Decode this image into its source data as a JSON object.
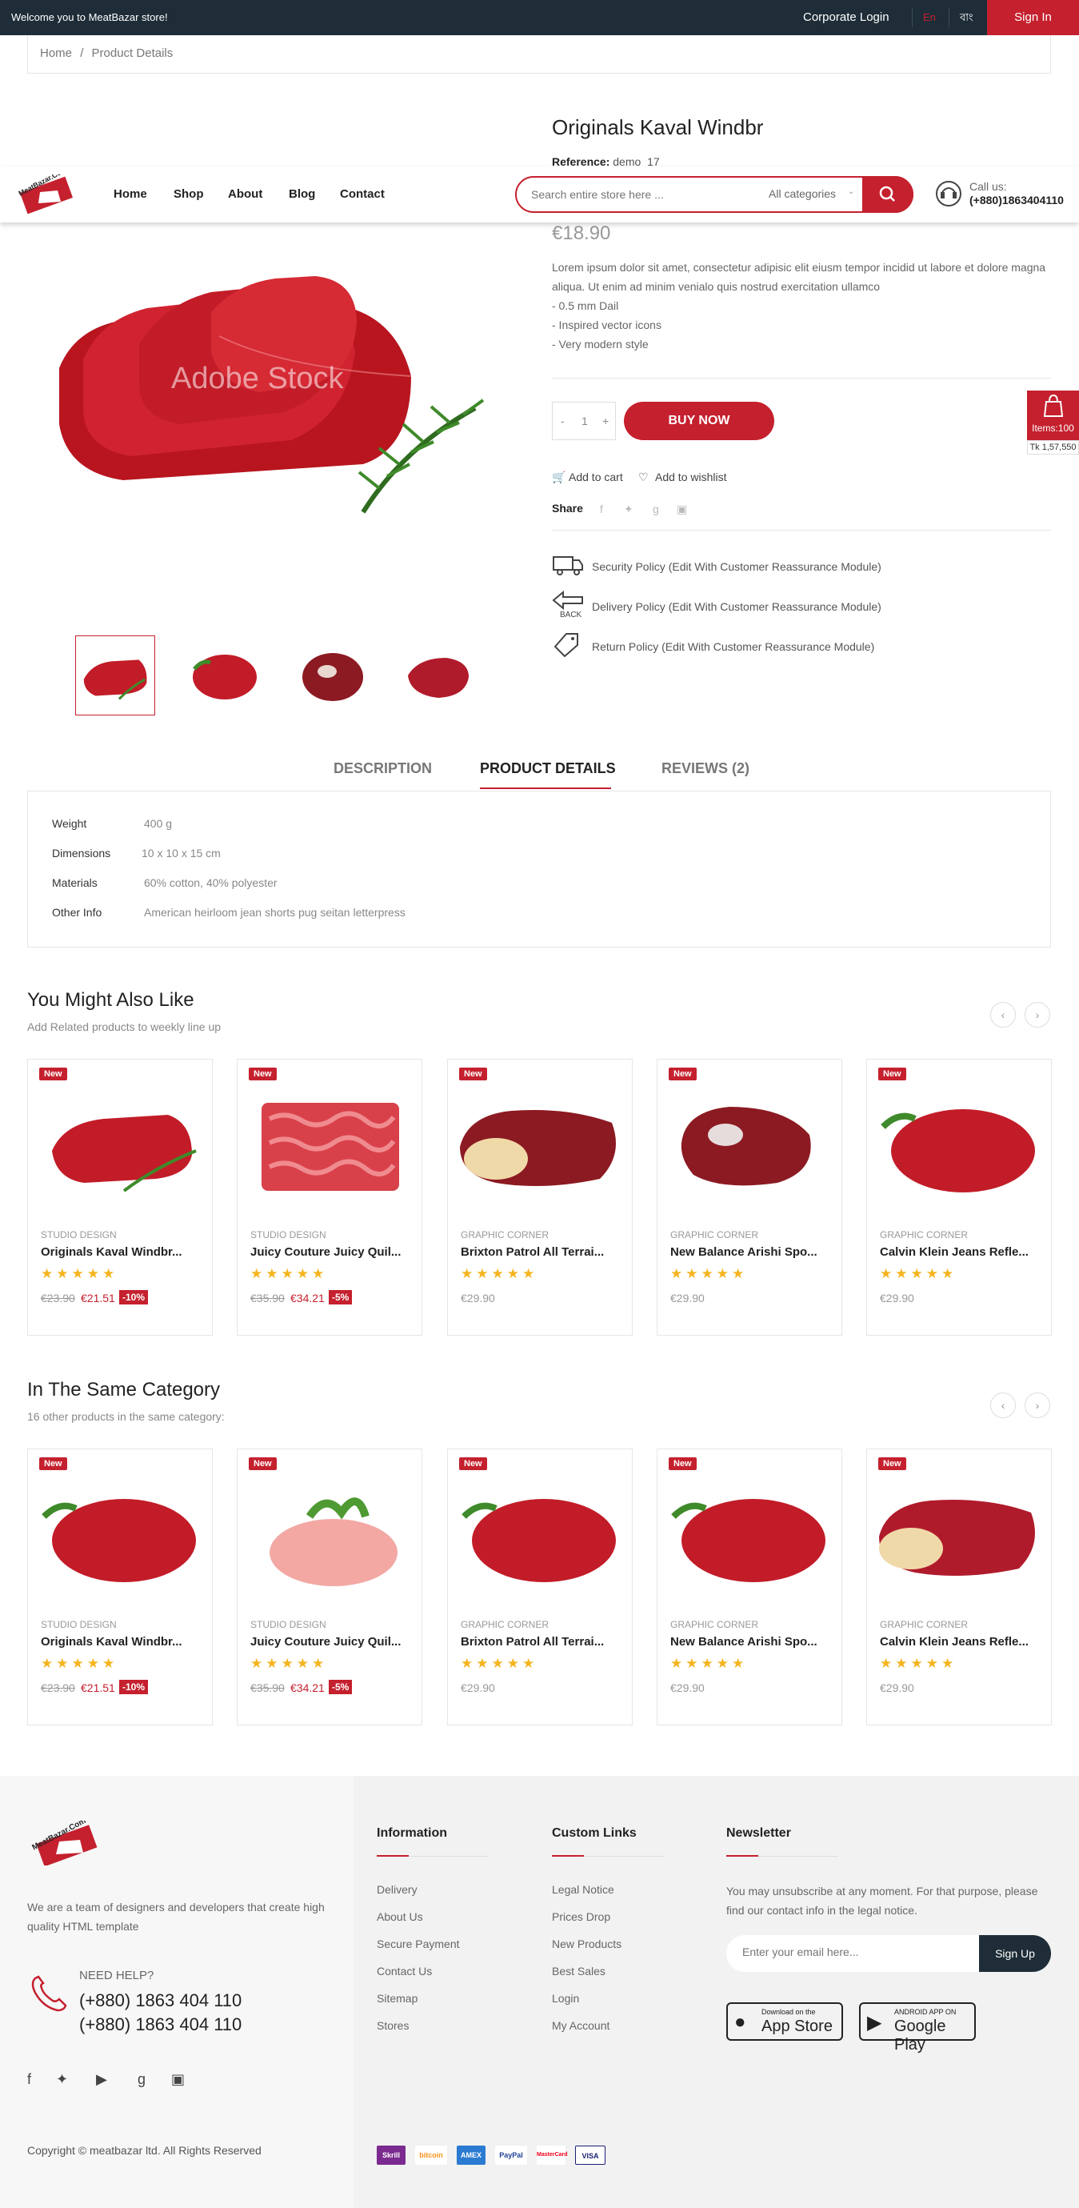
{
  "topbar": {
    "welcome": "Welcome you to MeatBazar store!",
    "corporate_login": "Corporate Login",
    "lang_en": "En",
    "lang_bn": "বাং",
    "sign_in": "Sign In"
  },
  "breadcrumb": {
    "home": "Home",
    "sep": "/",
    "current": "Product Details"
  },
  "header": {
    "logo_text": "MeatBazar.Com",
    "nav": [
      "Home",
      "Shop",
      "About",
      "Blog",
      "Contact"
    ],
    "search_placeholder": "Search entire store here ...",
    "category": "All categories",
    "call_label": "Call us:",
    "call_number": "(+880)1863404110"
  },
  "product": {
    "title": "Originals Kaval Windbr",
    "reference_label": "Reference:",
    "reference_value": "demo_17",
    "price": "€18.90",
    "description": "Lorem ipsum dolor sit amet, consectetur adipisic elit eiusm tempor incidid ut labore et dolore magna aliqua. Ut enim ad minim venialo quis nostrud exercitation ullamco",
    "features": [
      "- 0.5 mm Dail",
      "- Inspired vector icons",
      "- Very modern style"
    ],
    "qty_minus": "-",
    "qty_value": "1",
    "qty_plus": "+",
    "buy_now": "BUY NOW",
    "add_to_cart": "Add to cart",
    "add_to_wishlist": "Add to wishlist",
    "share_label": "Share",
    "policies": [
      "Security Policy (Edit With Customer Reassurance Module)",
      "Delivery Policy (Edit With Customer Reassurance Module)",
      "Return Policy (Edit With Customer Reassurance Module)"
    ],
    "watermark": "Adobe Stock"
  },
  "cart_float": {
    "items": "Items:100",
    "total": "Tk 1,57,550"
  },
  "tabs": [
    "DESCRIPTION",
    "PRODUCT DETAILS",
    "REVIEWS (2)"
  ],
  "details": [
    {
      "label": "Weight",
      "value": "400 g"
    },
    {
      "label": "Dimensions",
      "value": "10 x 10 x 15 cm"
    },
    {
      "label": "Materials",
      "value": "60% cotton, 40% polyester"
    },
    {
      "label": "Other Info",
      "value": "American heirloom jean shorts pug seitan letterpress"
    }
  ],
  "related": {
    "title": "You Might Also Like",
    "subtitle": "Add Related products to weekly line up",
    "prev": "‹",
    "next": "›",
    "products": [
      {
        "badge": "New",
        "brand": "STUDIO DESIGN",
        "name": "Originals Kaval Windbr...",
        "stars": "★★★★★",
        "old_price": "€23.90",
        "price": "€21.51",
        "discount": "-10%"
      },
      {
        "badge": "New",
        "brand": "STUDIO DESIGN",
        "name": "Juicy Couture Juicy Quil...",
        "stars": "★★★★★",
        "old_price": "€35.90",
        "price": "€34.21",
        "discount": "-5%"
      },
      {
        "badge": "New",
        "brand": "GRAPHIC CORNER",
        "name": "Brixton Patrol All Terrai...",
        "stars": "★★★★★",
        "price": "€29.90"
      },
      {
        "badge": "New",
        "brand": "GRAPHIC CORNER",
        "name": "New Balance Arishi Spo...",
        "stars": "★★★★★",
        "price": "€29.90"
      },
      {
        "badge": "New",
        "brand": "GRAPHIC CORNER",
        "name": "Calvin Klein Jeans Refle...",
        "stars": "★★★★★",
        "price": "€29.90"
      }
    ]
  },
  "same_category": {
    "title": "In The Same Category",
    "subtitle": "16 other products in the same category:",
    "prev": "‹",
    "next": "›",
    "products": [
      {
        "badge": "New",
        "brand": "STUDIO DESIGN",
        "name": "Originals Kaval Windbr...",
        "stars": "★★★★★",
        "old_price": "€23.90",
        "price": "€21.51",
        "discount": "-10%"
      },
      {
        "badge": "New",
        "brand": "STUDIO DESIGN",
        "name": "Juicy Couture Juicy Quil...",
        "stars": "★★★★★",
        "old_price": "€35.90",
        "price": "€34.21",
        "discount": "-5%"
      },
      {
        "badge": "New",
        "brand": "GRAPHIC CORNER",
        "name": "Brixton Patrol All Terrai...",
        "stars": "★★★★★",
        "price": "€29.90"
      },
      {
        "badge": "New",
        "brand": "GRAPHIC CORNER",
        "name": "New Balance Arishi Spo...",
        "stars": "★★★★★",
        "price": "€29.90"
      },
      {
        "badge": "New",
        "brand": "GRAPHIC CORNER",
        "name": "Calvin Klein Jeans Refle...",
        "stars": "★★★★★",
        "price": "€29.90"
      }
    ]
  },
  "footer": {
    "about": "We are a team of designers and developers that create high quality HTML template",
    "need_help": "NEED HELP?",
    "phones": [
      "(+880) 1863 404 110",
      "(+880) 1863 404 110"
    ],
    "social_icons": [
      "facebook-icon",
      "twitter-icon",
      "youtube-icon",
      "google-plus-icon",
      "instagram-icon"
    ],
    "information": {
      "title": "Information",
      "links": [
        "Delivery",
        "About Us",
        "Secure Payment",
        "Contact Us",
        "Sitemap",
        "Stores"
      ]
    },
    "custom_links": {
      "title": "Custom Links",
      "links": [
        "Legal Notice",
        "Prices Drop",
        "New Products",
        "Best Sales",
        "Login",
        "My Account"
      ]
    },
    "newsletter": {
      "title": "Newsletter",
      "text": "You may unsubscribe at any moment. For that purpose, please find our contact info in the legal notice.",
      "placeholder": "Enter your email here...",
      "signup": "Sign Up"
    },
    "app_store": {
      "small": "Download on the",
      "big": "App Store"
    },
    "google_play": {
      "small": "ANDROID APP ON",
      "big": "Google Play"
    },
    "copyright": "Copyright © meatbazar ltd. All Rights Reserved",
    "payments": [
      "Skrill",
      "bitcoin",
      "AMEX",
      "PayPal",
      "MasterCard",
      "VISA"
    ]
  },
  "colors": {
    "accent": "#c5202e",
    "dark": "#1e2d37",
    "star": "#f5b41e"
  }
}
